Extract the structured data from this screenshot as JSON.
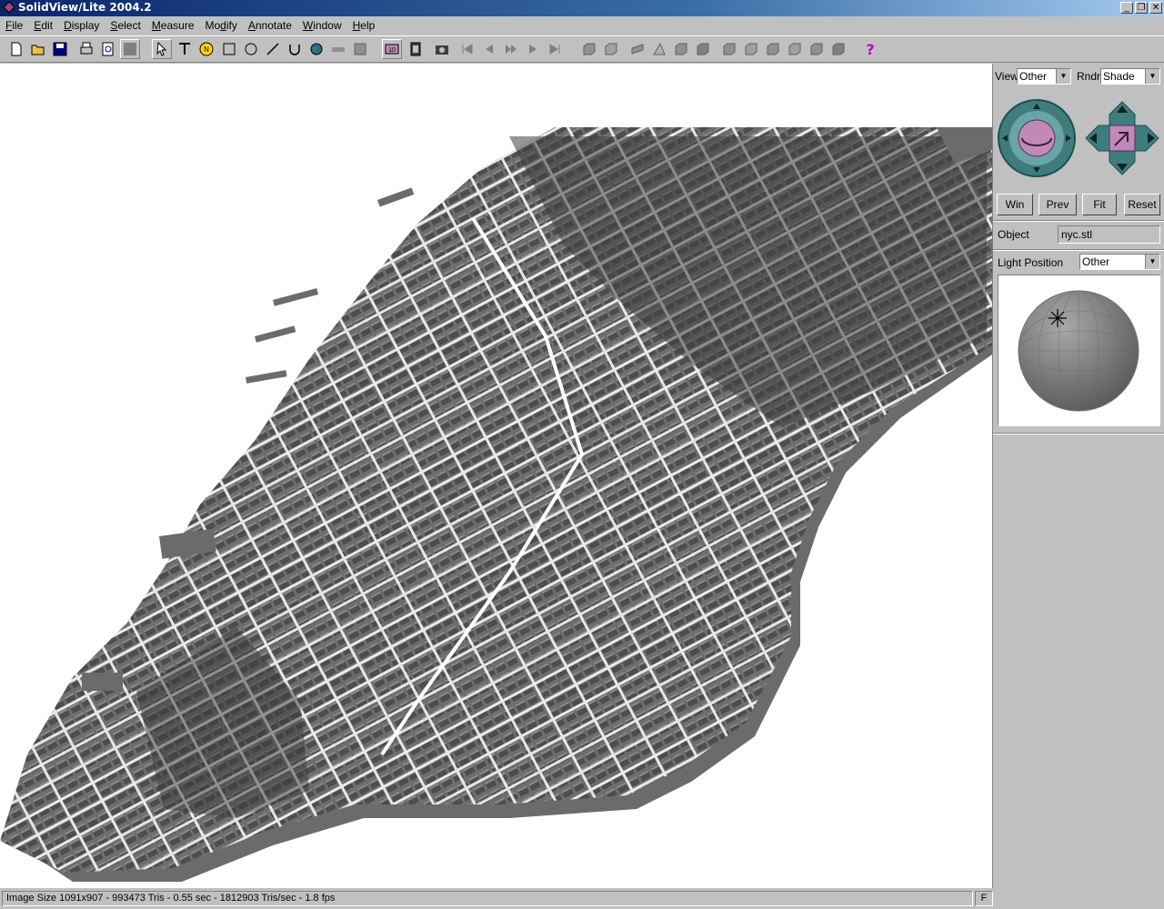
{
  "window": {
    "title": "SolidView/Lite 2004.2",
    "buttons": [
      "_",
      "❐",
      "✕"
    ]
  },
  "menu": [
    {
      "label": "File",
      "accel": "F",
      "rest": "ile"
    },
    {
      "label": "Edit",
      "accel": "E",
      "rest": "dit"
    },
    {
      "label": "Display",
      "accel": "D",
      "rest": "isplay"
    },
    {
      "label": "Select",
      "accel": "S",
      "rest": "elect"
    },
    {
      "label": "Measure",
      "accel": "M",
      "rest": "easure"
    },
    {
      "label": "Modify",
      "pre": "Mo",
      "accel": "d",
      "rest": "ify"
    },
    {
      "label": "Annotate",
      "accel": "A",
      "rest": "nnotate"
    },
    {
      "label": "Window",
      "accel": "W",
      "rest": "indow"
    },
    {
      "label": "Help",
      "accel": "H",
      "rest": "elp"
    }
  ],
  "toolbar_icons": [
    "new-file-icon",
    "open-folder-icon",
    "save-icon",
    "print-icon",
    "print-preview-icon",
    "blank-icon",
    "select-arrow-icon",
    "text-icon",
    "note-icon",
    "rectangle-icon",
    "circle-icon",
    "line-icon",
    "arc-icon",
    "earth-icon",
    "bar-icon",
    "box-icon",
    "dimension-icon",
    "film-icon",
    "camera-icon",
    "first-icon",
    "prev-icon",
    "play-icon",
    "next-icon",
    "last-icon",
    "view-1-icon",
    "view-2-icon",
    "view-3-icon",
    "view-4-icon",
    "view-5-icon",
    "view-6-icon",
    "view-7-icon",
    "view-8-icon",
    "view-9-icon",
    "view-10-icon",
    "view-11-icon",
    "view-12-icon",
    "help-icon"
  ],
  "panel": {
    "view_label": "View",
    "view_value": "Other",
    "rndr_label": "Rndr",
    "rndr_value": "Shade",
    "buttons": {
      "win": "Win",
      "prev": "Prev",
      "fit": "Fit",
      "reset": "Reset"
    },
    "object_label": "Object",
    "object_value": "nyc.stl",
    "light_label": "Light Position",
    "light_value": "Other",
    "colors": {
      "orbit_dial": "#3f7d7d",
      "orbit_center": "#c08ab8",
      "pan_pad": "#3f7d7d"
    }
  },
  "viewport": {
    "model": "nyc.stl",
    "colors": {
      "building": "#5a5a5a",
      "shadow": "#6b6b6b",
      "background": "#ffffff"
    }
  },
  "status": {
    "text": "Image Size 1091x907 - 993473 Tris -   0.55 sec - 1812903 Tris/sec -  1.8 fps",
    "indicator": "F"
  }
}
